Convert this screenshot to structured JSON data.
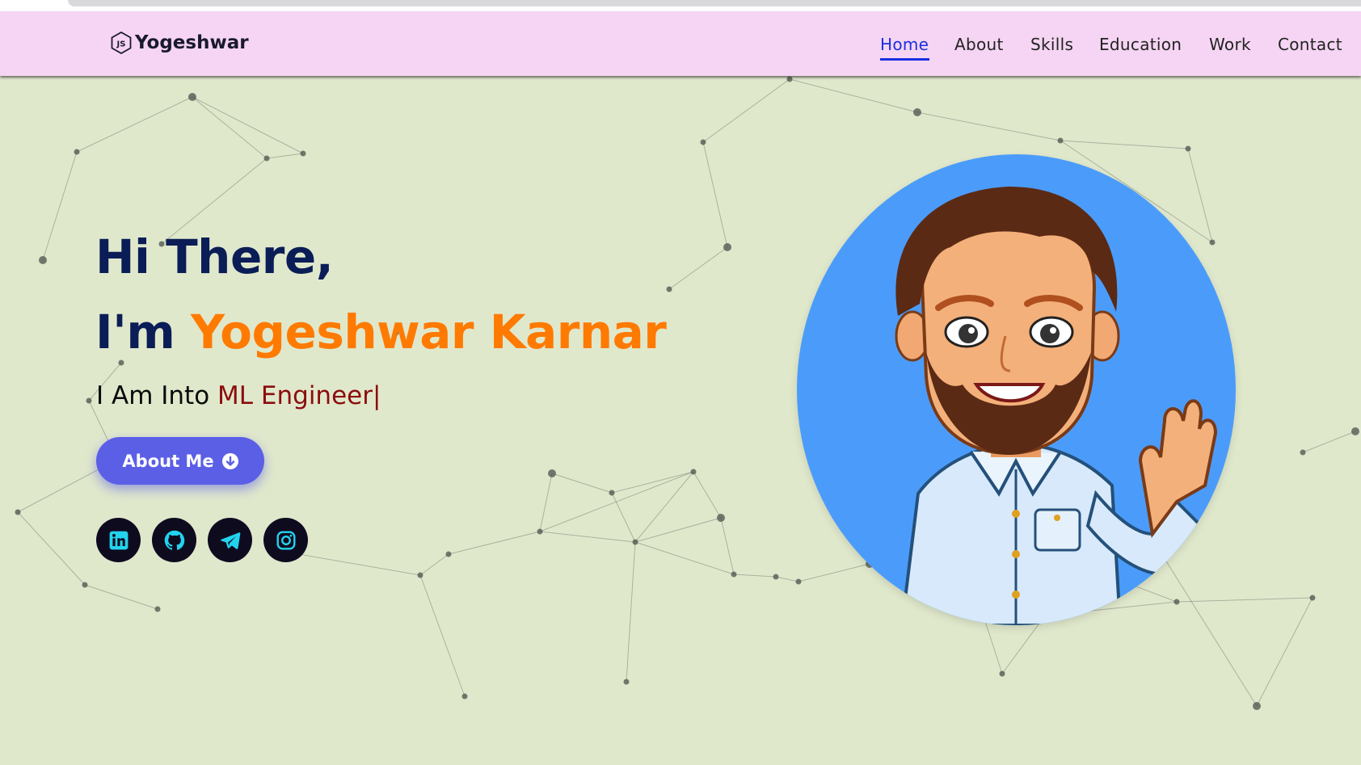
{
  "brand": {
    "name": "Yogeshwar",
    "icon": "js-logo-icon"
  },
  "nav": {
    "items": [
      {
        "label": "Home",
        "active": true
      },
      {
        "label": "About"
      },
      {
        "label": "Skills"
      },
      {
        "label": "Education"
      },
      {
        "label": "Work"
      },
      {
        "label": "Contact"
      }
    ]
  },
  "hero": {
    "greeting": "Hi There,",
    "intro_prefix": "I'm",
    "name": "Yogeshwar Karnar",
    "tagline_prefix": "I Am Into",
    "role": "ML Engineer|",
    "cta_label": "About Me",
    "cta_icon": "arrow-circle-down-icon"
  },
  "socials": [
    {
      "name": "linkedin-icon"
    },
    {
      "name": "github-icon"
    },
    {
      "name": "telegram-icon"
    },
    {
      "name": "instagram-icon"
    }
  ],
  "avatar": {
    "name": "bitmoji-avatar",
    "background": "#4b9cfa"
  },
  "colors": {
    "navbar_bg": "#f5d5f3",
    "page_bg": "#e0e8cc",
    "heading": "#0a1d56",
    "name_accent": "#ff7a00",
    "role_accent": "#8b0d0d",
    "nav_active": "#1b2fe0",
    "button": "#5b5fe6",
    "social_bg": "#0f0b1f",
    "social_icon": "#22d3ee"
  }
}
